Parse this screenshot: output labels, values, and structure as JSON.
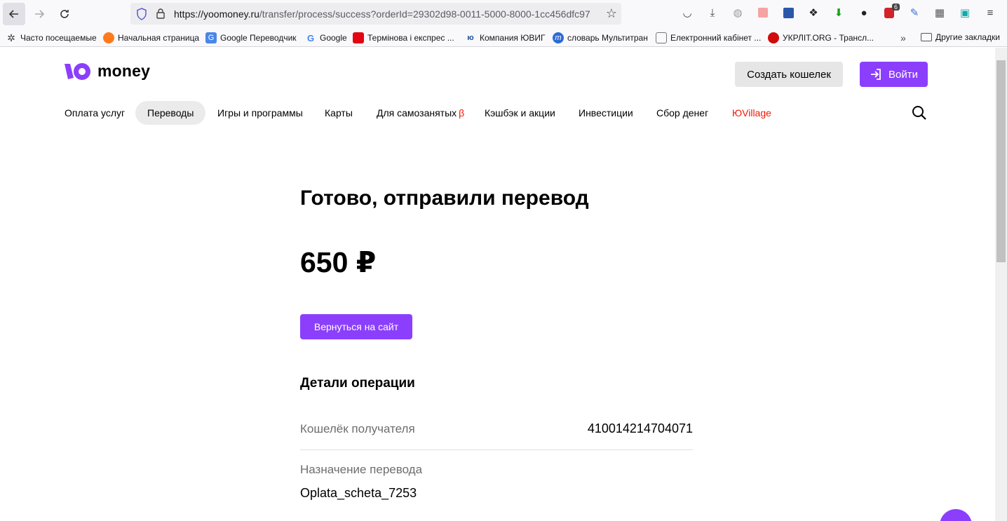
{
  "browser": {
    "url_host": "https://yoomoney.ru",
    "url_path": "/transfer/process/success?orderId=29302d98-0011-5000-8000-1cc456dfc97",
    "bookmarks": [
      {
        "label": "Часто посещаемые"
      },
      {
        "label": "Начальная страница"
      },
      {
        "label": "Google Переводчик"
      },
      {
        "label": "Google"
      },
      {
        "label": "Термінова і експрес ..."
      },
      {
        "label": "Компания ЮВИГ"
      },
      {
        "label": "словарь Мультитран"
      },
      {
        "label": "Електронний кабінет ..."
      },
      {
        "label": "УКРЛІТ.ORG - Трансл..."
      }
    ],
    "other_bookmarks": "Другие закладки",
    "ext_badge": "6"
  },
  "header": {
    "logo_text": "money",
    "create_wallet": "Создать кошелек",
    "login": "Войти",
    "brand_color": "#8b3ffd"
  },
  "nav": {
    "items": [
      {
        "label": "Оплата услуг"
      },
      {
        "label": "Переводы"
      },
      {
        "label": "Игры и программы"
      },
      {
        "label": "Карты"
      },
      {
        "label": "Для самозанятых"
      },
      {
        "label": "Кэшбэк и акции"
      },
      {
        "label": "Инвестиции"
      },
      {
        "label": "Сбор денег"
      },
      {
        "label": "ЮVillage"
      }
    ],
    "beta_mark": "β"
  },
  "main": {
    "title": "Готово, отправили перевод",
    "amount": "650 ₽",
    "back_button": "Вернуться на сайт",
    "details_title": "Детали операции",
    "recipient_label": "Кошелёк получателя",
    "recipient_value": "410014214704071",
    "purpose_label": "Назначение перевода",
    "purpose_value": "Oplata_scheta_7253"
  }
}
